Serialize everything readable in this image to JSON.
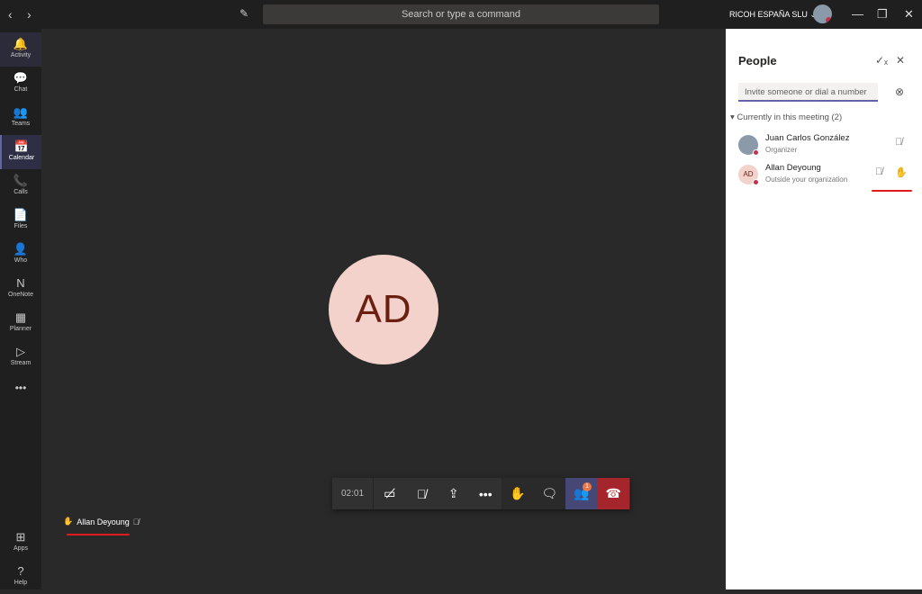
{
  "topbar": {
    "search_placeholder": "Search or type a command",
    "org": "RICOH ESPAÑA SLU ⌄",
    "back": "‹",
    "forward": "›"
  },
  "sidebar": {
    "items": [
      {
        "label": "Activity",
        "icon": "🔔"
      },
      {
        "label": "Chat",
        "icon": "💬"
      },
      {
        "label": "Teams",
        "icon": "👥"
      },
      {
        "label": "Calendar",
        "icon": "📅"
      },
      {
        "label": "Calls",
        "icon": "📞"
      },
      {
        "label": "Files",
        "icon": "📄"
      },
      {
        "label": "Who",
        "icon": "👤"
      },
      {
        "label": "OneNote",
        "icon": "N"
      },
      {
        "label": "Planner",
        "icon": "▦"
      },
      {
        "label": "Stream",
        "icon": "▷"
      }
    ],
    "more": "•••",
    "apps": {
      "label": "Apps",
      "icon": "⊞"
    },
    "help": {
      "label": "Help",
      "icon": "?"
    }
  },
  "stage": {
    "avatar_initials": "AD",
    "participant_name": "Allan Deyoung"
  },
  "toolbar": {
    "timer": "02:01",
    "badge_count": "1"
  },
  "people_panel": {
    "title": "People",
    "invite_placeholder": "Invite someone or dial a number",
    "section": "Currently in this meeting",
    "count": "(2)",
    "participants": [
      {
        "name": "Juan Carlos González",
        "role": "Organizer",
        "initials": ""
      },
      {
        "name": "Allan Deyoung",
        "role": "Outside your organization",
        "initials": "AD"
      }
    ]
  },
  "colors": {
    "accent": "#6264a7",
    "hangup": "#a4262c",
    "status": "#c4314b"
  }
}
